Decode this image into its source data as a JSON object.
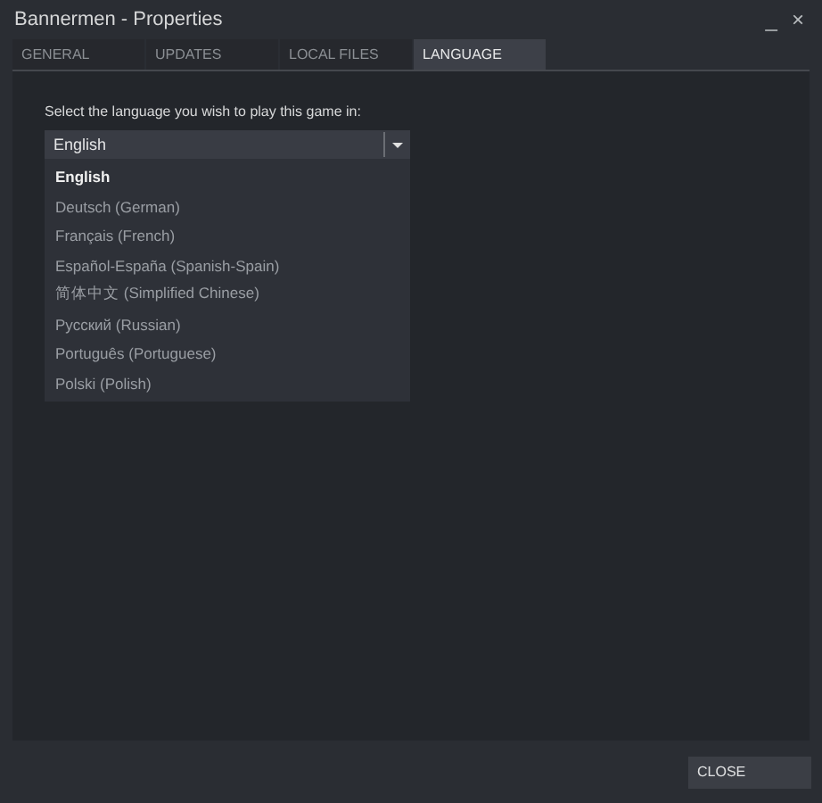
{
  "window": {
    "title": "Bannermen - Properties",
    "controls": [
      "_",
      "×"
    ]
  },
  "tabs": [
    {
      "label": "GENERAL",
      "selected": false
    },
    {
      "label": "UPDATES",
      "selected": false
    },
    {
      "label": "LOCAL FILES",
      "selected": false
    },
    {
      "label": "LANGUAGE",
      "selected": true
    }
  ],
  "language": {
    "prompt": "Select the language you wish to play this game in:",
    "value": "English",
    "expanded": true,
    "options": [
      {
        "label": "English",
        "selected": true
      },
      {
        "label": "Deutsch (German)",
        "selected": false
      },
      {
        "label": "Français (French)",
        "selected": false
      },
      {
        "label": "Español-España (Spanish-Spain)",
        "selected": false
      },
      {
        "label": "简体中文 (Simplified Chinese)",
        "selected": false
      },
      {
        "label": "Русский (Russian)",
        "selected": false
      },
      {
        "label": "Português (Portuguese)",
        "selected": false
      },
      {
        "label": "Polski (Polish)",
        "selected": false
      }
    ]
  },
  "buttons": [
    "CLOSE"
  ]
}
